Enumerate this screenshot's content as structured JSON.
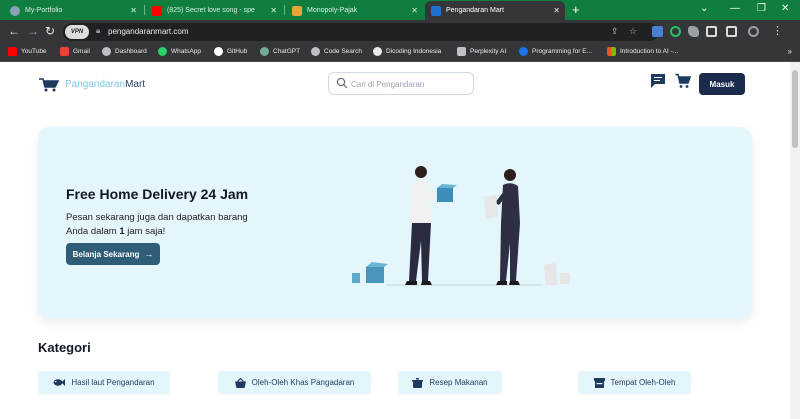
{
  "browser": {
    "tabs": [
      {
        "title": "My-Portfolio",
        "favicon_color": "#8aa3b8",
        "active": false
      },
      {
        "title": "(825) Secret love song - spe",
        "favicon_color": "#ff0000",
        "active": false
      },
      {
        "title": "Monopoly-Pajak",
        "favicon_color": "#e9a13b",
        "active": false
      },
      {
        "title": "Pengandaran Mart",
        "favicon_color": "#1f6fd1",
        "active": true
      }
    ],
    "url": "pengandaranmart.com",
    "vpn_badge": "VPN",
    "bookmarks": [
      {
        "label": "YouTube",
        "icon_color": "#ff0000"
      },
      {
        "label": "Gmail",
        "icon_color": "#ea4335"
      },
      {
        "label": "Dashboard",
        "icon_color": "#bdc1c6"
      },
      {
        "label": "WhatsApp",
        "icon_color": "#25d366"
      },
      {
        "label": "GitHub",
        "icon_color": "#ffffff"
      },
      {
        "label": "ChatGPT",
        "icon_color": "#74aa9c"
      },
      {
        "label": "Code Search",
        "icon_color": "#bdc1c6"
      },
      {
        "label": "Dicoding Indonesia",
        "icon_color": "#e8eaed"
      },
      {
        "label": "Perplexity AI",
        "icon_color": "#bdc1c6"
      },
      {
        "label": "Programming for E...",
        "icon_color": "#1a73e8"
      },
      {
        "label": "Introduction to AI -...",
        "icon_color": "#f25022"
      }
    ]
  },
  "header": {
    "logo_part1": "Pangandaran",
    "logo_part2": "Mart",
    "search_placeholder": "Cari di Pengandaran",
    "login_label": "Masuk"
  },
  "hero": {
    "title": "Free Home Delivery 24 Jam",
    "subtitle_line1": "Pesan sekarang juga dan dapatkan barang",
    "subtitle_line2_prefix": "Anda dalam ",
    "subtitle_line2_bold": "1",
    "subtitle_line2_suffix": " jam saja!",
    "cta_label": "Belanja Sekarang",
    "cta_icon": "arrow-right-icon"
  },
  "categories": {
    "title": "Kategori",
    "items": [
      {
        "label": "Hasil laut Pengandaran",
        "icon": "fish-icon"
      },
      {
        "label": "Oleh-Oleh Khas Pangadaran",
        "icon": "basket-icon"
      },
      {
        "label": "Resep Makanan",
        "icon": "cooking-pot-icon"
      },
      {
        "label": "Tempat Oleh-Oleh",
        "icon": "shop-icon"
      }
    ]
  },
  "colors": {
    "brand_dark": "#1a2b4d",
    "brand_light": "#7fc4e6",
    "hero_bg": "#e4f5fc",
    "cta_bg": "#2f5d78",
    "tabstrip": "#0f7e3f"
  }
}
